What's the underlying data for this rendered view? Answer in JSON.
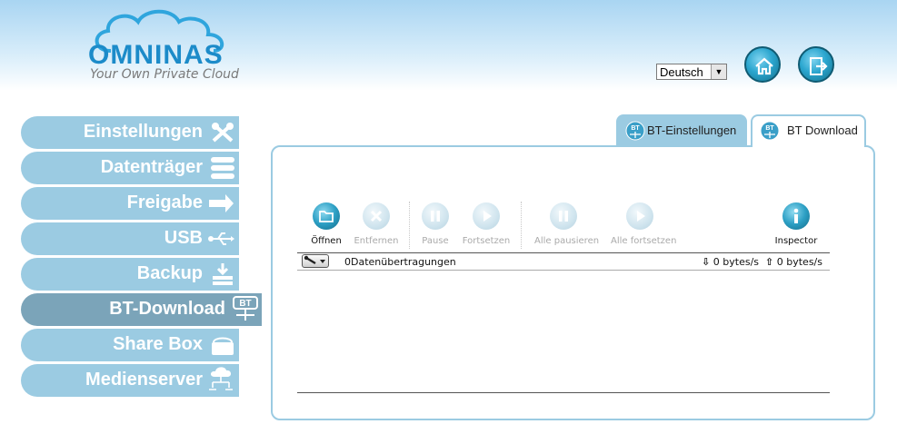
{
  "header": {
    "logo_text": "OMNINAS",
    "tagline": "Your Own Private Cloud",
    "language": {
      "selected": "Deutsch"
    },
    "buttons": [
      {
        "name": "home",
        "icon": "home-icon"
      },
      {
        "name": "logout",
        "icon": "logout-icon"
      }
    ]
  },
  "sidebar": {
    "items": [
      {
        "label": "Einstellungen",
        "icon": "tools-icon",
        "active": false
      },
      {
        "label": "Datenträger",
        "icon": "storage-icon",
        "active": false
      },
      {
        "label": "Freigabe",
        "icon": "share-arrow-icon",
        "active": false
      },
      {
        "label": "USB",
        "icon": "usb-icon",
        "active": false
      },
      {
        "label": "Backup",
        "icon": "backup-icon",
        "active": false
      },
      {
        "label": "BT-Download",
        "icon": "bt-icon",
        "active": true
      },
      {
        "label": "Share Box",
        "icon": "sharebox-icon",
        "active": false
      },
      {
        "label": "Medienserver",
        "icon": "mediaserver-icon",
        "active": false
      }
    ]
  },
  "tabs": [
    {
      "label": "BT-Einstellungen",
      "active": false
    },
    {
      "label": "BT Download",
      "active": true
    }
  ],
  "toolbar": [
    {
      "label": "Öffnen",
      "icon": "open-folder-icon",
      "enabled": true
    },
    {
      "label": "Entfernen",
      "icon": "remove-icon",
      "enabled": false
    },
    {
      "label": "Pause",
      "icon": "pause-icon",
      "enabled": false
    },
    {
      "label": "Fortsetzen",
      "icon": "play-icon",
      "enabled": false
    },
    {
      "label": "Alle pausieren",
      "icon": "pause-all-icon",
      "enabled": false
    },
    {
      "label": "Alle fortsetzen",
      "icon": "resume-all-icon",
      "enabled": false
    },
    {
      "label": "Inspector",
      "icon": "info-icon",
      "enabled": true
    }
  ],
  "status": {
    "transfers": "0Datenübertragungen",
    "download_speed": "0 bytes/s",
    "upload_speed": "0 bytes/s"
  },
  "colors": {
    "nav": "#9bcbe2",
    "nav_active": "#7ba4b9",
    "brand": "#1c8bc9"
  }
}
